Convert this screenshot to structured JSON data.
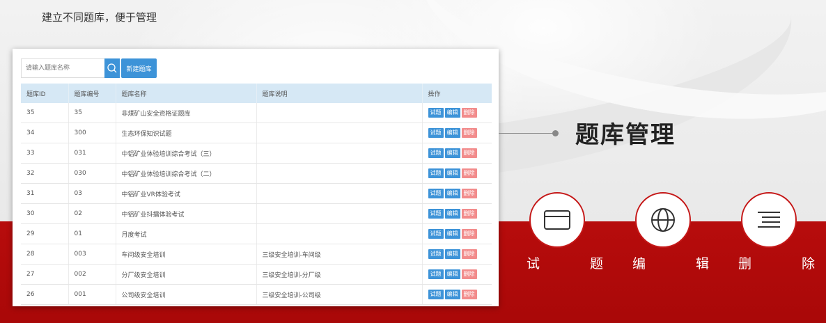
{
  "caption": "建立不同题库，便于管理",
  "search": {
    "placeholder": "请输入题库名称",
    "button_icon": "search-icon"
  },
  "toolbar": {
    "new_label": "新建题库"
  },
  "table": {
    "headers": [
      "题库ID",
      "题库编号",
      "题库名称",
      "题库说明",
      "操作"
    ],
    "rows": [
      [
        "35",
        "35",
        "非煤矿山安全资格证题库",
        ""
      ],
      [
        "34",
        "300",
        "生态环保知识试题",
        ""
      ],
      [
        "33",
        "031",
        "中铝矿业体验培训综合考试（三）",
        ""
      ],
      [
        "32",
        "030",
        "中铝矿业体验培训综合考试（二）",
        ""
      ],
      [
        "31",
        "03",
        "中铝矿业VR体验考试",
        ""
      ],
      [
        "30",
        "02",
        "中铝矿业抖擂体验考试",
        ""
      ],
      [
        "29",
        "01",
        "月度考试",
        ""
      ],
      [
        "28",
        "003",
        "车间级安全培训",
        "三级安全培训-车间级"
      ],
      [
        "27",
        "002",
        "分厂级安全培训",
        "三级安全培训-分厂级"
      ],
      [
        "26",
        "001",
        "公司级安全培训",
        "三级安全培训-公司级"
      ]
    ],
    "actions": [
      "试题",
      "编辑",
      "删除"
    ]
  },
  "heading": "题库管理",
  "features": [
    {
      "icon": "card-icon",
      "chars": [
        "试",
        "题"
      ]
    },
    {
      "icon": "globe-icon",
      "chars": [
        "编",
        "辑"
      ]
    },
    {
      "icon": "lines-icon",
      "chars": [
        "删",
        "除"
      ]
    }
  ],
  "colors": {
    "accent_blue": "#3d93d8",
    "danger_pink": "#f28c8c",
    "brand_red": "#b70c0c",
    "header_blue": "#d6e8f5"
  }
}
